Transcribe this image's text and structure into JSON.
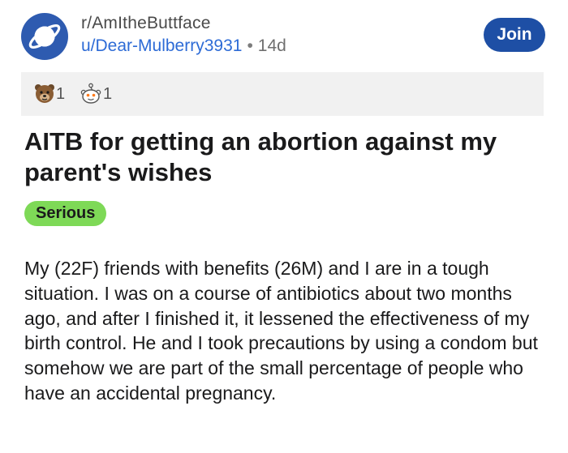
{
  "post": {
    "subreddit": "r/AmItheButtface",
    "author": "u/Dear-Mulberry3931",
    "separator": "•",
    "age": "14d",
    "join_label": "Join",
    "subreddit_icon": "planet-icon",
    "awards": [
      {
        "icon": "bear-award-icon",
        "count": "1"
      },
      {
        "icon": "wholesome-award-icon",
        "count": "1"
      }
    ],
    "title": "AITB for getting an abortion against my parent's wishes",
    "flair": "Serious",
    "body": "My (22F) friends with benefits (26M) and I are in a tough situation. I was on a course of antibiotics about two months ago, and after I finished it, it lessened the effectiveness of my birth control. He and I took precautions by using a condom but somehow we are part of the small percentage of people who have an accidental pregnancy."
  },
  "colors": {
    "join_button": "#1e4fa5",
    "username": "#2d6bd6",
    "flair_bg": "#7ed957",
    "awards_bg": "#f1f1f1",
    "subreddit_icon_bg": "#2e5bb0"
  }
}
